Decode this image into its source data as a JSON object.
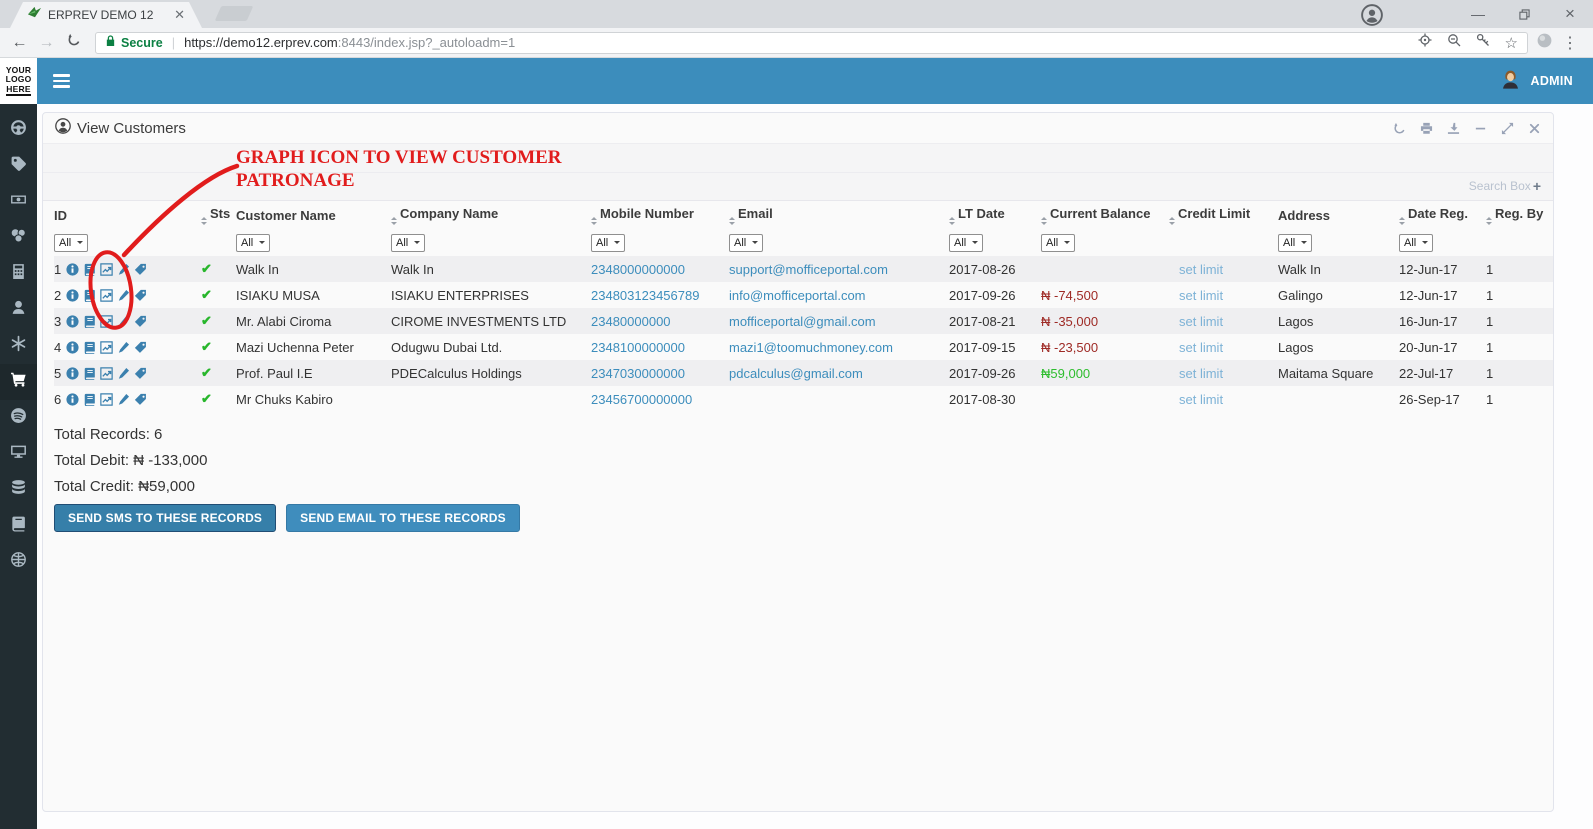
{
  "browser": {
    "tab_title": "ERPREV DEMO 12",
    "url": {
      "secure_label": "Secure",
      "main": "https://demo12.erprev.com",
      "rest": ":8443/index.jsp?_autoloadm=1"
    }
  },
  "header": {
    "logo_lines": [
      "YOUR",
      "LOGO",
      "HERE"
    ],
    "user_label": "ADMIN"
  },
  "sidebar": {
    "items": [
      {
        "icon": "dashboard",
        "active": false
      },
      {
        "icon": "tags",
        "active": false
      },
      {
        "icon": "cash",
        "active": false
      },
      {
        "icon": "coins",
        "active": false
      },
      {
        "icon": "calculator",
        "active": false
      },
      {
        "icon": "user",
        "active": false
      },
      {
        "icon": "snowflake",
        "active": false
      },
      {
        "icon": "cart",
        "active": true
      },
      {
        "icon": "disc",
        "active": false
      },
      {
        "icon": "monitor",
        "active": false
      },
      {
        "icon": "database",
        "active": false
      },
      {
        "icon": "book",
        "active": false
      },
      {
        "icon": "globe",
        "active": false
      }
    ]
  },
  "panel": {
    "title": "View Customers",
    "search_box_label": "Search Box",
    "search_box_plus": "+"
  },
  "annotation": {
    "line1": "GRAPH ICON TO VIEW CUSTOMER",
    "line2": "PATRONAGE"
  },
  "table": {
    "filter_value": "All",
    "row_actions": [
      "info",
      "ledger",
      "chart",
      "edit",
      "tag"
    ],
    "columns": [
      {
        "label": "ID",
        "sort": false,
        "filter": true
      },
      {
        "label": "Sts",
        "sort": true,
        "filter": false
      },
      {
        "label": "Customer Name",
        "sort": false,
        "filter": true
      },
      {
        "label": "Company Name",
        "sort": true,
        "filter": true
      },
      {
        "label": "Mobile Number",
        "sort": true,
        "filter": true
      },
      {
        "label": "Email",
        "sort": true,
        "filter": true
      },
      {
        "label": "LT Date",
        "sort": true,
        "filter": true
      },
      {
        "label": "Current Balance",
        "sort": true,
        "filter": true
      },
      {
        "label": "Credit Limit",
        "sort": true,
        "filter": false
      },
      {
        "label": "Address",
        "sort": false,
        "filter": true
      },
      {
        "label": "Date Reg.",
        "sort": true,
        "filter": true
      },
      {
        "label": "Reg. By",
        "sort": true,
        "filter": false
      }
    ],
    "rows": [
      {
        "id": "1",
        "status": "active",
        "customer_name": "Walk In",
        "company_name": "Walk In",
        "mobile": "2348000000000",
        "email": "support@mofficeportal.com",
        "lt_date": "2017-08-26",
        "balance": "",
        "balance_sign": "none",
        "credit_limit": "set limit",
        "address": "Walk In",
        "date_reg": "12-Jun-17",
        "reg_by": "1"
      },
      {
        "id": "2",
        "status": "active",
        "customer_name": "ISIAKU MUSA",
        "company_name": "ISIAKU ENTERPRISES",
        "mobile": "234803123456789",
        "email": "info@mofficeportal.com",
        "lt_date": "2017-09-26",
        "balance": "₦ -74,500",
        "balance_sign": "negative",
        "credit_limit": "set limit",
        "address": "Galingo",
        "date_reg": "12-Jun-17",
        "reg_by": "1"
      },
      {
        "id": "3",
        "status": "active",
        "customer_name": "Mr. Alabi Ciroma",
        "company_name": "CIROME INVESTMENTS LTD",
        "mobile": "23480000000",
        "email": "mofficeportal@gmail.com",
        "lt_date": "2017-08-21",
        "balance": "₦ -35,000",
        "balance_sign": "negative",
        "credit_limit": "set limit",
        "address": "Lagos",
        "date_reg": "16-Jun-17",
        "reg_by": "1"
      },
      {
        "id": "4",
        "status": "active",
        "customer_name": "Mazi Uchenna Peter",
        "company_name": "Odugwu Dubai Ltd.",
        "mobile": "2348100000000",
        "email": "mazi1@toomuchmoney.com",
        "lt_date": "2017-09-15",
        "balance": "₦ -23,500",
        "balance_sign": "negative",
        "credit_limit": "set limit",
        "address": "Lagos",
        "date_reg": "20-Jun-17",
        "reg_by": "1"
      },
      {
        "id": "5",
        "status": "active",
        "customer_name": "Prof. Paul I.E",
        "company_name": "PDECalculus Holdings",
        "mobile": "2347030000000",
        "email": "pdcalculus@gmail.com",
        "lt_date": "2017-09-26",
        "balance": "₦59,000",
        "balance_sign": "positive",
        "credit_limit": "set limit",
        "address": "Maitama Square",
        "date_reg": "22-Jul-17",
        "reg_by": "1"
      },
      {
        "id": "6",
        "status": "active",
        "customer_name": "Mr Chuks Kabiro",
        "company_name": "",
        "mobile": "23456700000000",
        "email": "",
        "lt_date": "2017-08-30",
        "balance": "",
        "balance_sign": "none",
        "credit_limit": "set limit",
        "address": "",
        "date_reg": "26-Sep-17",
        "reg_by": "1"
      }
    ]
  },
  "summary": {
    "total_records": "Total Records: 6",
    "total_debit": "Total Debit: ₦ -133,000",
    "total_credit": "Total Credit: ₦59,000"
  },
  "buttons": {
    "send_sms": "SEND SMS TO THESE RECORDS",
    "send_email": "SEND EMAIL TO THESE RECORDS"
  },
  "colors": {
    "brand_blue": "#3c8dbc",
    "sidebar_bg": "#222d32",
    "sidebar_active_bg": "#1e282c",
    "link_blue": "#3c8dbc",
    "link_light": "#7db2d6",
    "negative_red": "#9e2a25",
    "positive_green": "#2ebd2e",
    "check_green": "#28b62c",
    "annotation_red": "#e11c1c",
    "secure_green": "#0c8043",
    "button_sms": "#367fa9",
    "button_email": "#3f8dbd"
  }
}
